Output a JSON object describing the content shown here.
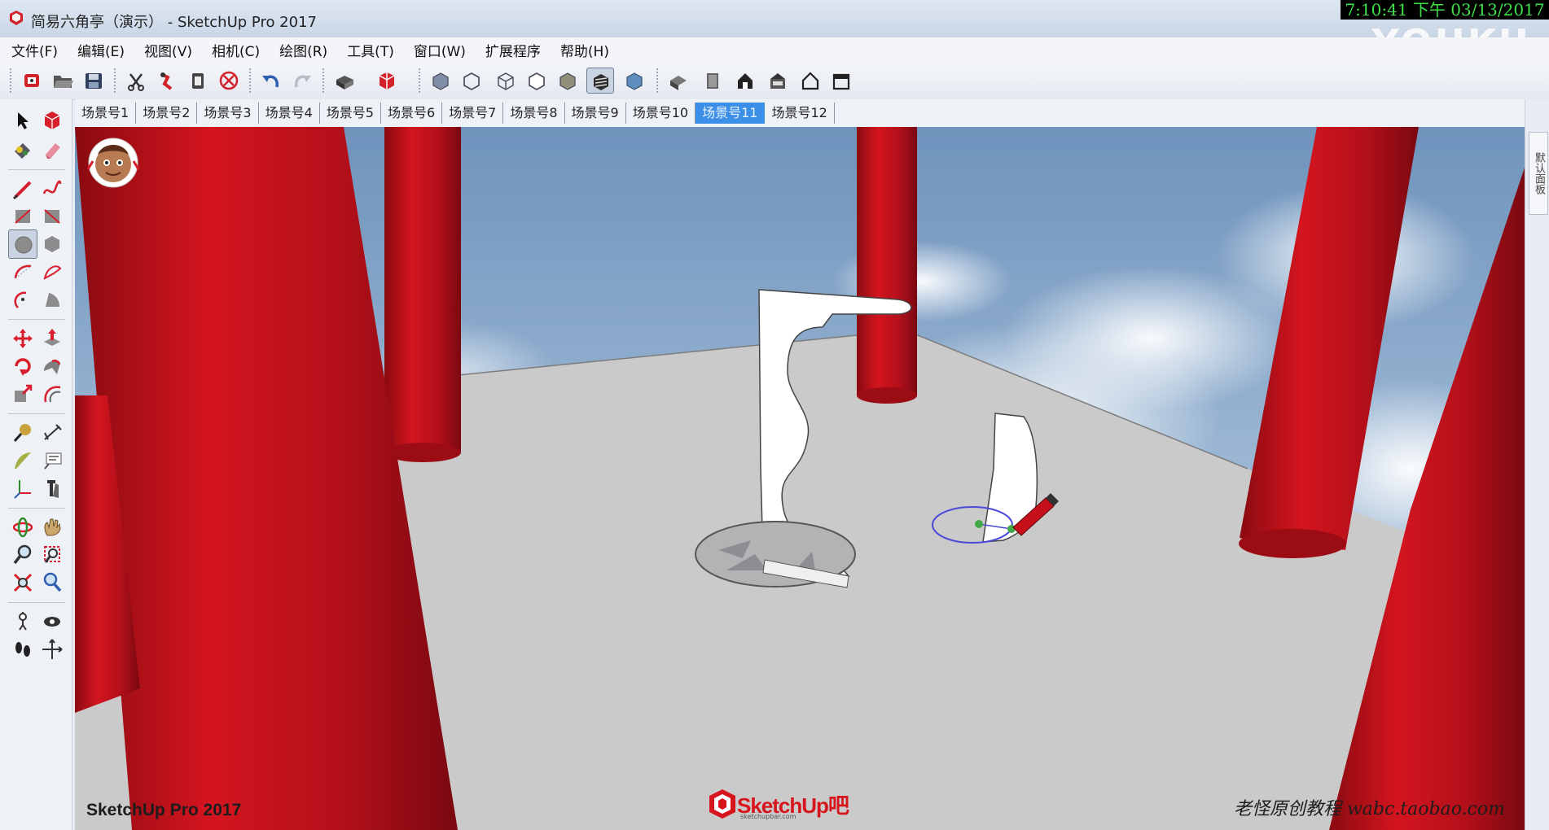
{
  "window": {
    "title": "简易六角亭（演示） - SketchUp Pro 2017",
    "clock": "7:10:41 下午 03/13/2017",
    "watermark": "YOUKU"
  },
  "menu": {
    "items": [
      "文件(F)",
      "编辑(E)",
      "视图(V)",
      "相机(C)",
      "绘图(R)",
      "工具(T)",
      "窗口(W)",
      "扩展程序",
      "帮助(H)"
    ]
  },
  "toolbar": {
    "buttons": [
      "model-info-icon",
      "open-icon",
      "save-icon",
      "cut-icon",
      "copy-icon",
      "paste-icon",
      "erase-icon",
      "undo-icon",
      "redo-icon",
      "print-icon",
      "components-icon",
      "xray-icon",
      "backface-icon",
      "wireframe-icon",
      "hidden-line-icon",
      "shaded-icon",
      "shaded-textures-icon",
      "monochrome-icon",
      "iso-view-icon",
      "top-view-icon",
      "front-view-icon",
      "right-view-icon",
      "back-view-icon",
      "left-view-icon"
    ],
    "pressed": "shaded-textures-icon"
  },
  "left_tools": {
    "pressed": "circle-tool-icon",
    "accent": "#d81e2c"
  },
  "scenes": {
    "tabs": [
      "场景号1",
      "场景号2",
      "场景号3",
      "场景号4",
      "场景号5",
      "场景号6",
      "场景号7",
      "场景号8",
      "场景号9",
      "场景号10",
      "场景号11",
      "场景号12"
    ],
    "active_index": 10
  },
  "tray": {
    "label": "默认面板"
  },
  "viewport": {
    "label": "SketchUp Pro 2017",
    "credit": "老怪原创教程 wabc.taobao.com",
    "logo_text": "SketchUp吧",
    "logo_sub": "sketchupbar.com",
    "column_color": "#c0121a",
    "floor_color": "#c9c9ca",
    "sky_color": "#8fb0d0"
  }
}
